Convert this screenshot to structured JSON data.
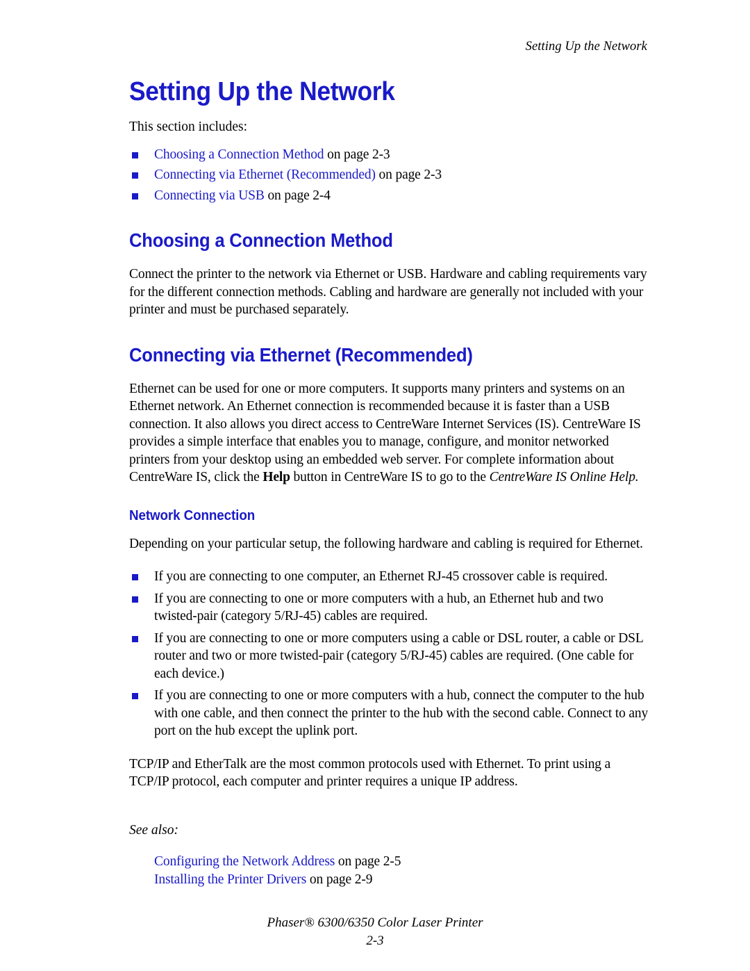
{
  "page": {
    "running_header": "Setting Up the Network",
    "footer_title": "Phaser® 6300/6350 Color Laser Printer",
    "footer_page_number": "2-3",
    "link_color": "#1a1ac8",
    "heading_color": "#1a1ac8",
    "body_color": "#000000"
  },
  "title": "Setting Up the Network",
  "intro": {
    "lead": "This section includes:",
    "links": [
      {
        "text": "Choosing a Connection Method",
        "suffix": " on page 2-3"
      },
      {
        "text": "Connecting via Ethernet (Recommended)",
        "suffix": " on page 2-3"
      },
      {
        "text": "Connecting via USB",
        "suffix": " on page 2-4"
      }
    ]
  },
  "section_choosing": {
    "heading": "Choosing a Connection Method",
    "paragraph": "Connect the printer to the network via Ethernet or USB. Hardware and cabling requirements vary for the different connection methods. Cabling and hardware are generally not included with your printer and must be purchased separately."
  },
  "section_ethernet": {
    "heading": "Connecting via Ethernet (Recommended)",
    "paragraph_part1": "Ethernet can be used for one or more computers. It supports many printers and systems on an Ethernet network. An Ethernet connection is recommended because it is faster than a USB connection. It also allows you direct access to CentreWare Internet Services (IS). CentreWare IS provides a simple interface that enables you to manage, configure, and monitor networked printers from your desktop using an embedded web server. For complete information about CentreWare IS, click the ",
    "paragraph_bold": "Help",
    "paragraph_part2": " button in CentreWare IS to go to the ",
    "paragraph_italic": "CentreWare IS Online Help."
  },
  "subsection_network_connection": {
    "heading": "Network Connection",
    "intro": "Depending on your particular setup, the following hardware and cabling is required for Ethernet.",
    "bullets": [
      "If you are connecting to one computer, an Ethernet RJ-45 crossover cable is required.",
      "If you are connecting to one or more computers with a hub, an Ethernet hub and two twisted-pair (category 5/RJ-45) cables are required.",
      "If you are connecting to one or more computers using a cable or DSL router, a cable or DSL router and two or more twisted-pair (category 5/RJ-45) cables are required. (One cable for each device.)",
      "If you are connecting to one or more computers with a hub, connect the computer to the hub with one cable, and then connect the printer to the hub with the second cable. Connect to any port on the hub except the uplink port."
    ],
    "closing_paragraph": "TCP/IP and EtherTalk are the most common protocols used with Ethernet. To print using a TCP/IP protocol, each computer and printer requires a unique IP address."
  },
  "see_also": {
    "label": "See also:",
    "links": [
      {
        "text": "Configuring the Network Address",
        "suffix": " on page 2-5"
      },
      {
        "text": "Installing the Printer Drivers",
        "suffix": " on page 2-9"
      }
    ]
  }
}
